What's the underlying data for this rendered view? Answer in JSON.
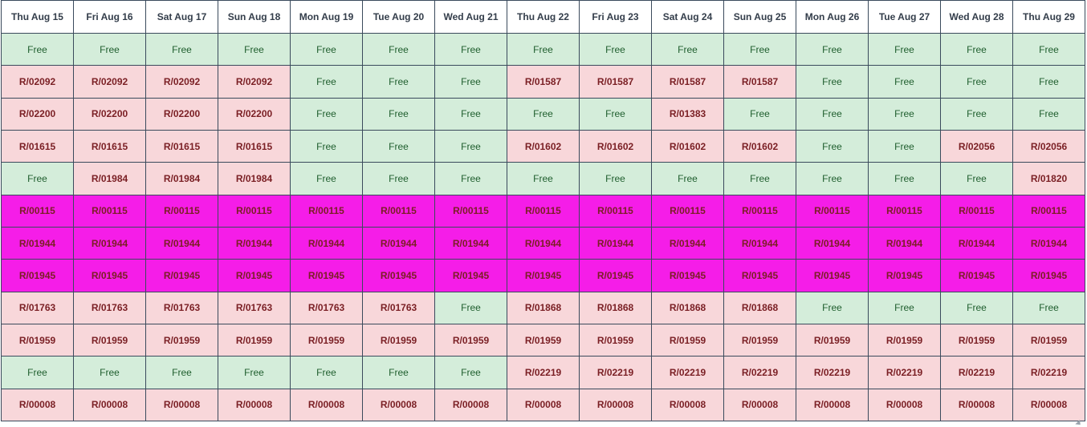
{
  "colors": {
    "free_bg": "#d4edda",
    "free_text": "#1f5e2e",
    "booked_bg": "#f8d7da",
    "booked_text": "#7a1f24",
    "highlight_bg": "#f51de8",
    "border": "#3a4a5c"
  },
  "calendar": {
    "days": [
      "Thu Aug 15",
      "Fri Aug 16",
      "Sat Aug 17",
      "Sun Aug 18",
      "Mon Aug 19",
      "Tue Aug 20",
      "Wed Aug 21",
      "Thu Aug 22",
      "Fri Aug 23",
      "Sat Aug 24",
      "Sun Aug 25",
      "Mon Aug 26",
      "Tue Aug 27",
      "Wed Aug 28",
      "Thu Aug 29"
    ],
    "rows": [
      {
        "highlight": false,
        "cells": [
          "Free",
          "Free",
          "Free",
          "Free",
          "Free",
          "Free",
          "Free",
          "Free",
          "Free",
          "Free",
          "Free",
          "Free",
          "Free",
          "Free",
          "Free"
        ]
      },
      {
        "highlight": false,
        "cells": [
          "R/02092",
          "R/02092",
          "R/02092",
          "R/02092",
          "Free",
          "Free",
          "Free",
          "R/01587",
          "R/01587",
          "R/01587",
          "R/01587",
          "Free",
          "Free",
          "Free",
          "Free"
        ]
      },
      {
        "highlight": false,
        "cells": [
          "R/02200",
          "R/02200",
          "R/02200",
          "R/02200",
          "Free",
          "Free",
          "Free",
          "Free",
          "Free",
          "R/01383",
          "Free",
          "Free",
          "Free",
          "Free",
          "Free"
        ]
      },
      {
        "highlight": false,
        "cells": [
          "R/01615",
          "R/01615",
          "R/01615",
          "R/01615",
          "Free",
          "Free",
          "Free",
          "R/01602",
          "R/01602",
          "R/01602",
          "R/01602",
          "Free",
          "Free",
          "R/02056",
          "R/02056"
        ]
      },
      {
        "highlight": false,
        "cells": [
          "Free",
          "R/01984",
          "R/01984",
          "R/01984",
          "Free",
          "Free",
          "Free",
          "Free",
          "Free",
          "Free",
          "Free",
          "Free",
          "Free",
          "Free",
          "R/01820"
        ]
      },
      {
        "highlight": true,
        "cells": [
          "R/00115",
          "R/00115",
          "R/00115",
          "R/00115",
          "R/00115",
          "R/00115",
          "R/00115",
          "R/00115",
          "R/00115",
          "R/00115",
          "R/00115",
          "R/00115",
          "R/00115",
          "R/00115",
          "R/00115"
        ]
      },
      {
        "highlight": true,
        "cells": [
          "R/01944",
          "R/01944",
          "R/01944",
          "R/01944",
          "R/01944",
          "R/01944",
          "R/01944",
          "R/01944",
          "R/01944",
          "R/01944",
          "R/01944",
          "R/01944",
          "R/01944",
          "R/01944",
          "R/01944"
        ]
      },
      {
        "highlight": true,
        "cells": [
          "R/01945",
          "R/01945",
          "R/01945",
          "R/01945",
          "R/01945",
          "R/01945",
          "R/01945",
          "R/01945",
          "R/01945",
          "R/01945",
          "R/01945",
          "R/01945",
          "R/01945",
          "R/01945",
          "R/01945"
        ]
      },
      {
        "highlight": false,
        "cells": [
          "R/01763",
          "R/01763",
          "R/01763",
          "R/01763",
          "R/01763",
          "R/01763",
          "Free",
          "R/01868",
          "R/01868",
          "R/01868",
          "R/01868",
          "Free",
          "Free",
          "Free",
          "Free"
        ]
      },
      {
        "highlight": false,
        "cells": [
          "R/01959",
          "R/01959",
          "R/01959",
          "R/01959",
          "R/01959",
          "R/01959",
          "R/01959",
          "R/01959",
          "R/01959",
          "R/01959",
          "R/01959",
          "R/01959",
          "R/01959",
          "R/01959",
          "R/01959"
        ]
      },
      {
        "highlight": false,
        "cells": [
          "Free",
          "Free",
          "Free",
          "Free",
          "Free",
          "Free",
          "Free",
          "R/02219",
          "R/02219",
          "R/02219",
          "R/02219",
          "R/02219",
          "R/02219",
          "R/02219",
          "R/02219"
        ]
      },
      {
        "highlight": false,
        "cells": [
          "R/00008",
          "R/00008",
          "R/00008",
          "R/00008",
          "R/00008",
          "R/00008",
          "R/00008",
          "R/00008",
          "R/00008",
          "R/00008",
          "R/00008",
          "R/00008",
          "R/00008",
          "R/00008",
          "R/00008"
        ]
      }
    ]
  }
}
